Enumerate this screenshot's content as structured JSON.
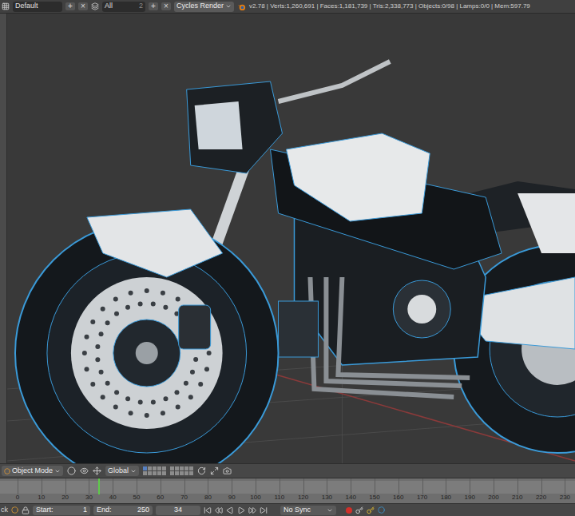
{
  "top_bar": {
    "screen_layout": {
      "name": "Default",
      "add": "+",
      "remove": "×"
    },
    "scene": {
      "name": "All",
      "users": "2",
      "add": "+",
      "remove": "×"
    },
    "render_engine": "Cycles Render",
    "stats": "v2.78 | Verts:1,260,691 | Faces:1,181,739 | Tris:2,338,773 | Objects:0/98 | Lamps:0/0 | Mem:597.79"
  },
  "viewport_header": {
    "mode": "Object Mode",
    "orientation": "Global",
    "layers": [
      {
        "active": true
      },
      {
        "active": false
      },
      {
        "active": false
      },
      {
        "active": false
      },
      {
        "active": false
      },
      {
        "active": false
      },
      {
        "active": false
      },
      {
        "active": false
      },
      {
        "active": false
      },
      {
        "active": false
      },
      {
        "active": false
      },
      {
        "active": false
      },
      {
        "active": false
      },
      {
        "active": false
      },
      {
        "active": false
      },
      {
        "active": false
      },
      {
        "active": false
      },
      {
        "active": false
      },
      {
        "active": false
      },
      {
        "active": false
      }
    ]
  },
  "timeline": {
    "ticks": [
      "0",
      "10",
      "20",
      "30",
      "40",
      "50",
      "60",
      "70",
      "80",
      "90",
      "100",
      "110",
      "120",
      "130",
      "140",
      "150",
      "160",
      "170",
      "180",
      "190",
      "200",
      "210",
      "220",
      "230"
    ],
    "current_frame": "34"
  },
  "playback_bar": {
    "menu": "ck",
    "start_label": "Start:",
    "start": "1",
    "end_label": "End:",
    "end": "250",
    "frame": "34",
    "sync": "No Sync"
  }
}
